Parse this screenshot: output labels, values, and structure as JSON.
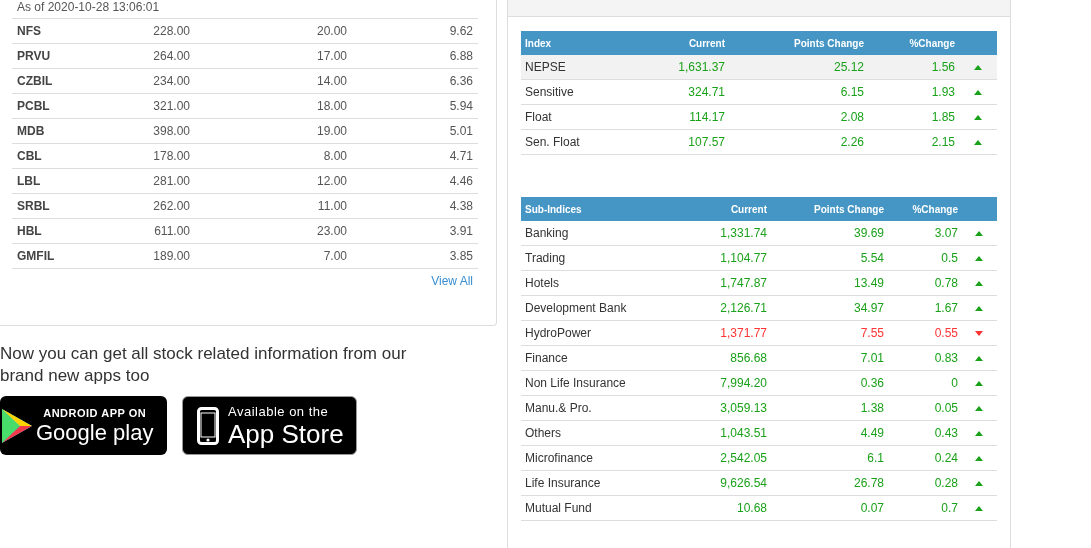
{
  "top_gainers": {
    "timestamp": "As of 2020-10-28 13:06:01",
    "rows": [
      {
        "symbol": "NFS",
        "column_2": "228.00",
        "column_3": "20.00",
        "column_4": "9.62"
      },
      {
        "symbol": "PRVU",
        "column_2": "264.00",
        "column_3": "17.00",
        "column_4": "6.88"
      },
      {
        "symbol": "CZBIL",
        "column_2": "234.00",
        "column_3": "14.00",
        "column_4": "6.36"
      },
      {
        "symbol": "PCBL",
        "column_2": "321.00",
        "column_3": "18.00",
        "column_4": "5.94"
      },
      {
        "symbol": "MDB",
        "column_2": "398.00",
        "column_3": "19.00",
        "column_4": "5.01"
      },
      {
        "symbol": "CBL",
        "column_2": "178.00",
        "column_3": "8.00",
        "column_4": "4.71"
      },
      {
        "symbol": "LBL",
        "column_2": "281.00",
        "column_3": "12.00",
        "column_4": "4.46"
      },
      {
        "symbol": "SRBL",
        "column_2": "262.00",
        "column_3": "11.00",
        "column_4": "4.38"
      },
      {
        "symbol": "HBL",
        "column_2": "611.00",
        "column_3": "23.00",
        "column_4": "3.91"
      },
      {
        "symbol": "GMFIL",
        "column_2": "189.00",
        "column_3": "7.00",
        "column_4": "3.85"
      }
    ],
    "view_all": "View All"
  },
  "promo": {
    "text": "Now you can get all stock related information from our brand new apps too",
    "badges": [
      {
        "kind": "google_play",
        "line_1": "ANDROID APP ON",
        "line_2": "Google play"
      },
      {
        "kind": "app_store",
        "line_1": "Available on the",
        "line_2": "App Store"
      }
    ]
  },
  "market_information": {
    "indices": {
      "columns": [
        "Index",
        "Current",
        "Points Change",
        "%Change"
      ],
      "rows": [
        {
          "name": "NEPSE",
          "current": "1,631.37",
          "points_change": "25.12",
          "percent_change": "1.56",
          "rising": true,
          "highlighted": true
        },
        {
          "name": "Sensitive",
          "current": "324.71",
          "points_change": "6.15",
          "percent_change": "1.93",
          "rising": true,
          "highlighted": false
        },
        {
          "name": "Float",
          "current": "114.17",
          "points_change": "2.08",
          "percent_change": "1.85",
          "rising": true,
          "highlighted": false
        },
        {
          "name": "Sen. Float",
          "current": "107.57",
          "points_change": "2.26",
          "percent_change": "2.15",
          "rising": true,
          "highlighted": false
        }
      ]
    },
    "sub_indices": {
      "columns": [
        "Sub-Indices",
        "Current",
        "Points Change",
        "%Change"
      ],
      "rows": [
        {
          "name": "Banking",
          "current": "1,331.74",
          "points_change": "39.69",
          "percent_change": "3.07",
          "rising": true,
          "highlighted": false
        },
        {
          "name": "Trading",
          "current": "1,104.77",
          "points_change": "5.54",
          "percent_change": "0.5",
          "rising": true,
          "highlighted": false
        },
        {
          "name": "Hotels",
          "current": "1,747.87",
          "points_change": "13.49",
          "percent_change": "0.78",
          "rising": true,
          "highlighted": false
        },
        {
          "name": "Development Bank",
          "current": "2,126.71",
          "points_change": "34.97",
          "percent_change": "1.67",
          "rising": true,
          "highlighted": false
        },
        {
          "name": "HydroPower",
          "current": "1,371.77",
          "points_change": "7.55",
          "percent_change": "0.55",
          "rising": false,
          "highlighted": false
        },
        {
          "name": "Finance",
          "current": "856.68",
          "points_change": "7.01",
          "percent_change": "0.83",
          "rising": true,
          "highlighted": false
        },
        {
          "name": "Non Life Insurance",
          "current": "7,994.20",
          "points_change": "0.36",
          "percent_change": "0",
          "rising": true,
          "highlighted": false
        },
        {
          "name": "Manu.& Pro.",
          "current": "3,059.13",
          "points_change": "1.38",
          "percent_change": "0.05",
          "rising": true,
          "highlighted": false
        },
        {
          "name": "Others",
          "current": "1,043.51",
          "points_change": "4.49",
          "percent_change": "0.43",
          "rising": true,
          "highlighted": false
        },
        {
          "name": "Microfinance",
          "current": "2,542.05",
          "points_change": "6.1",
          "percent_change": "0.24",
          "rising": true,
          "highlighted": false
        },
        {
          "name": "Life Insurance",
          "current": "9,626.54",
          "points_change": "26.78",
          "percent_change": "0.28",
          "rising": true,
          "highlighted": false
        },
        {
          "name": "Mutual Fund",
          "current": "10.68",
          "points_change": "0.07",
          "percent_change": "0.7",
          "rising": true,
          "highlighted": false
        }
      ]
    }
  }
}
